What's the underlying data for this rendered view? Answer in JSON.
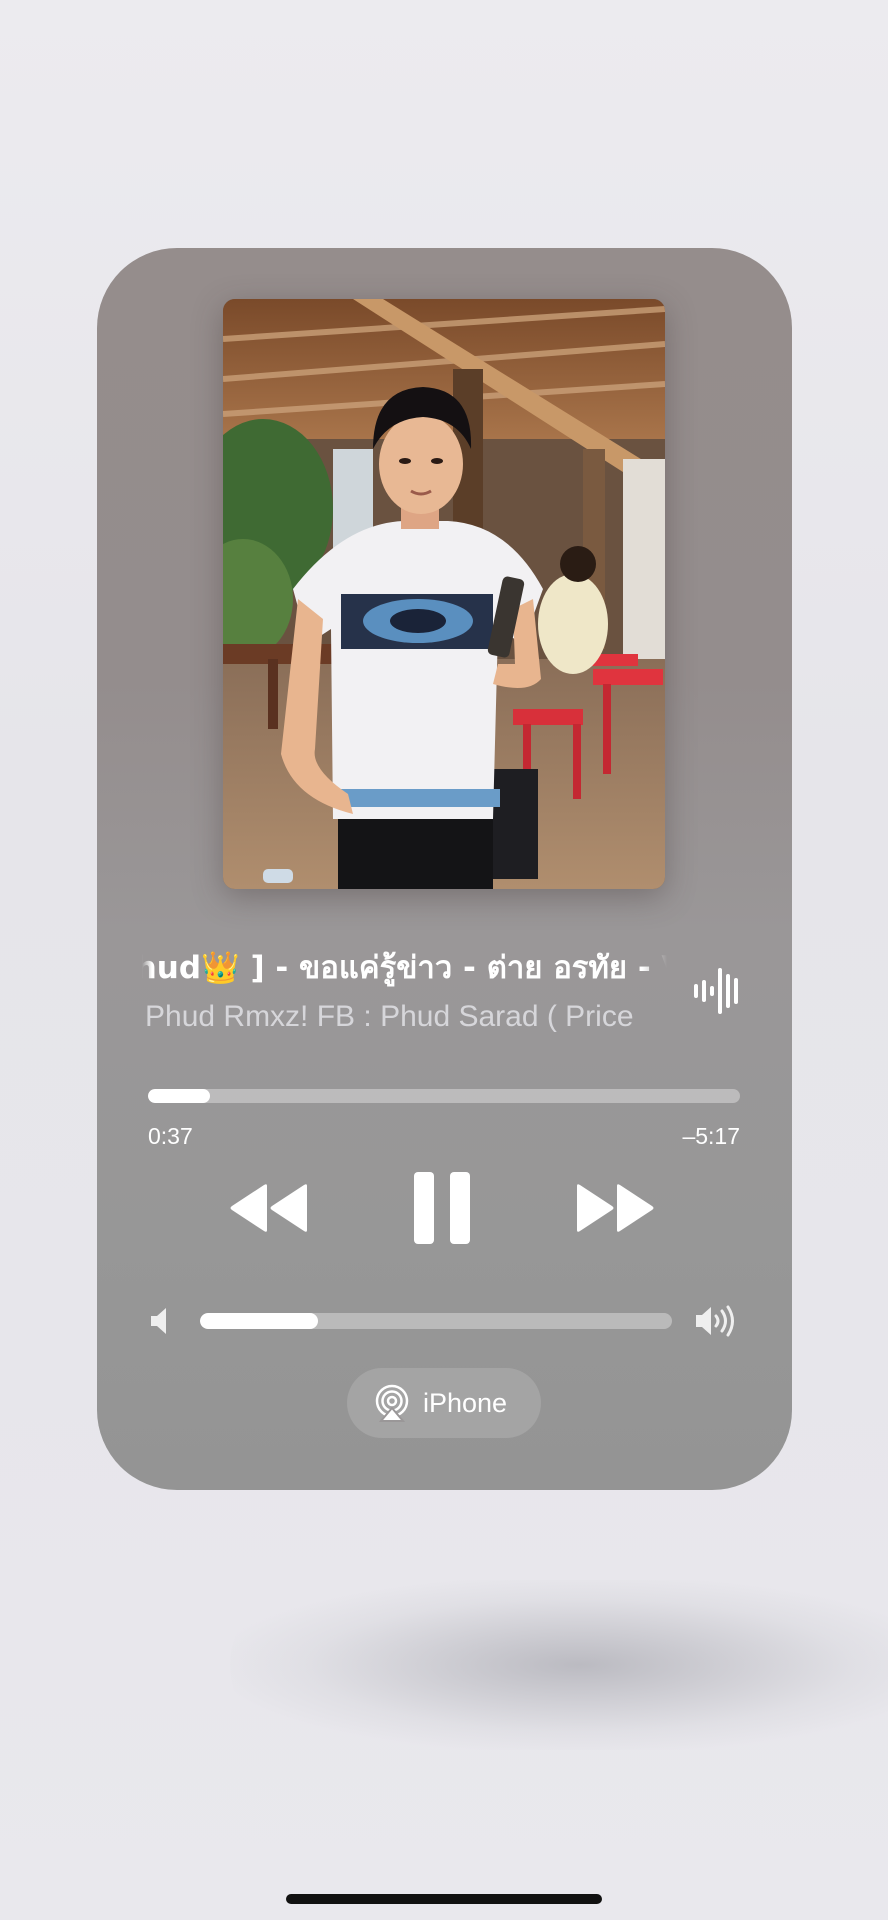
{
  "now_playing": {
    "title": "Phud👑 ] - ขอแค่รู้ข่าว - ต่าย อรทัย - V",
    "artist": "Phud Rmxz! FB : Phud Sarad ( Price",
    "elapsed": "0:37",
    "remaining": "–5:17",
    "progress_fraction": 0.105,
    "volume_fraction": 0.25
  },
  "controls": {
    "rewind_icon": "backward-icon",
    "pause_icon": "pause-icon",
    "forward_icon": "forward-icon",
    "volume_low_icon": "speaker-low-icon",
    "volume_high_icon": "speaker-high-icon",
    "waveform_icon": "waveform-icon"
  },
  "output": {
    "device_label": "iPhone",
    "icon": "airplay-icon"
  },
  "colors": {
    "card": "#968f8f",
    "foreground": "#ffffff",
    "track": "rgba(255,255,255,0.35)"
  }
}
